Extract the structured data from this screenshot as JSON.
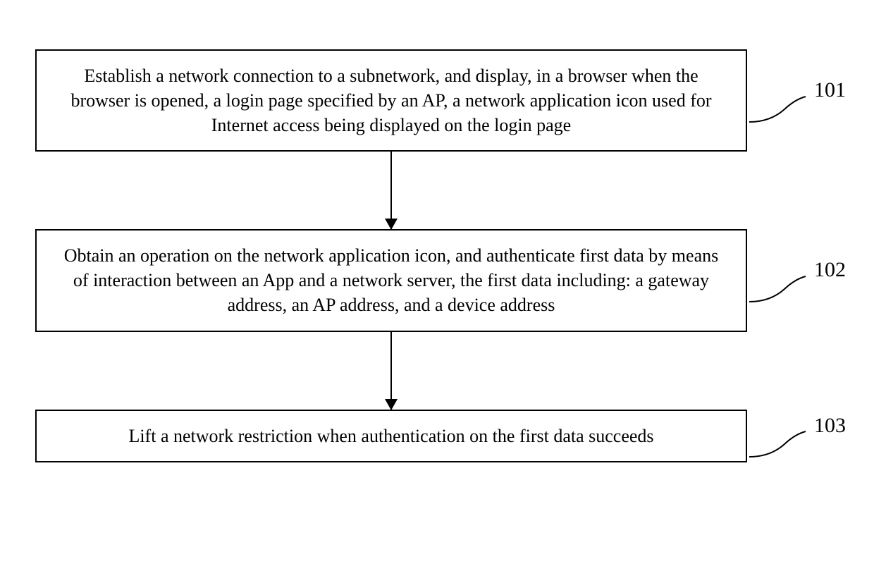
{
  "diagram": {
    "type": "flowchart",
    "direction": "top-down",
    "steps": [
      {
        "id": "101",
        "label": "101",
        "text": "Establish a network connection to a subnetwork, and display, in a browser when the browser is opened, a login page specified by an AP, a network application icon used for Internet access being displayed on the login page"
      },
      {
        "id": "102",
        "label": "102",
        "text": "Obtain an operation on the network application icon, and authenticate first data by means of interaction between an App and a network server, the first data including: a gateway address, an AP address, and a device address"
      },
      {
        "id": "103",
        "label": "103",
        "text": "Lift a network restriction when authentication on the first data succeeds"
      }
    ],
    "connections": [
      {
        "from": "101",
        "to": "102"
      },
      {
        "from": "102",
        "to": "103"
      }
    ]
  }
}
